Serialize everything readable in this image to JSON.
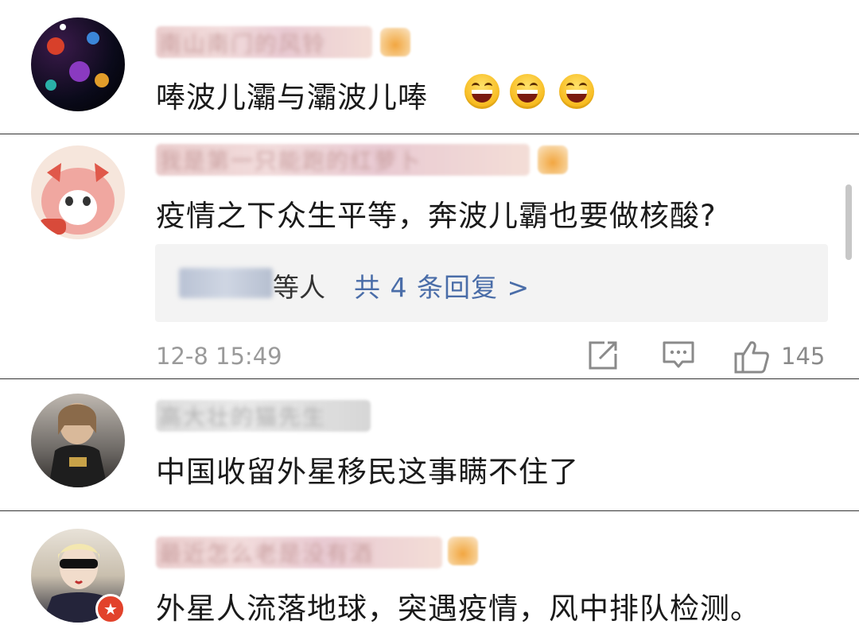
{
  "comments": [
    {
      "username": "南山南门的风铃",
      "text": "唪波儿灞与灞波儿唪",
      "emoji_count": 3
    },
    {
      "username": "我是第一只能跑的红萝卜",
      "text": "疫情之下众生平等，奔波儿霸也要做核酸?",
      "replies": {
        "who_suffix": "等人",
        "link": "共 4 条回复 >"
      },
      "time": "12-8 15:49",
      "likes": "145"
    },
    {
      "username": "高大壮的猫先生",
      "text": "中国收留外星移民这事瞒不住了"
    },
    {
      "username": "最近怎么老是没有酒",
      "text": "外星人流落地球，突遇疫情，风中排队检测。"
    }
  ],
  "icons": {
    "share": "share-icon",
    "comment": "comment-icon",
    "like": "thumbs-up-icon",
    "emoji": "grinning-face-icon",
    "vip": "vip-badge-icon"
  },
  "colors": {
    "link": "#4a6da8",
    "meta": "#9a9a9a",
    "divider": "#333333"
  }
}
